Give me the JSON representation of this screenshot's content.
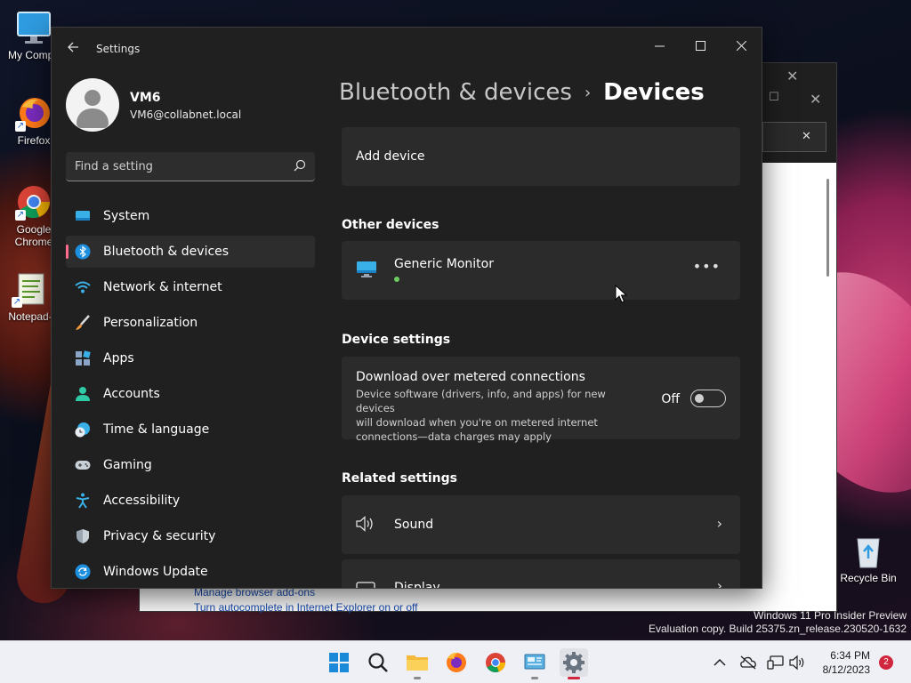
{
  "desktop": {
    "icons": [
      {
        "label": "My Compu",
        "icon": "computer-icon"
      },
      {
        "label": "Firefox",
        "icon": "firefox-icon"
      },
      {
        "label": "Google Chrome",
        "label_line1": "Google",
        "label_line2": "Chrome",
        "icon": "chrome-icon"
      },
      {
        "label": "Notepad-",
        "icon": "notepad-icon"
      },
      {
        "label": "Recycle Bin",
        "icon": "recycle-bin-icon"
      }
    ],
    "background_window": {
      "links": [
        "Manage browser add-ons",
        "Turn autocomplete in Internet Explorer on or off"
      ]
    },
    "watermark": {
      "line1": "Windows 11 Pro Insider Preview",
      "line2": "Evaluation copy. Build 25375.zn_release.230520-1632"
    }
  },
  "settings": {
    "window_title": "Settings",
    "profile": {
      "name": "VM6",
      "email": "VM6@collabnet.local"
    },
    "search": {
      "placeholder": "Find a setting"
    },
    "nav": [
      {
        "label": "System",
        "icon": "system-icon",
        "active": false
      },
      {
        "label": "Bluetooth & devices",
        "icon": "bluetooth-icon",
        "active": true
      },
      {
        "label": "Network & internet",
        "icon": "wifi-icon",
        "active": false
      },
      {
        "label": "Personalization",
        "icon": "brush-icon",
        "active": false
      },
      {
        "label": "Apps",
        "icon": "apps-icon",
        "active": false
      },
      {
        "label": "Accounts",
        "icon": "accounts-icon",
        "active": false
      },
      {
        "label": "Time & language",
        "icon": "time-language-icon",
        "active": false
      },
      {
        "label": "Gaming",
        "icon": "gamepad-icon",
        "active": false
      },
      {
        "label": "Accessibility",
        "icon": "accessibility-icon",
        "active": false
      },
      {
        "label": "Privacy & security",
        "icon": "shield-icon",
        "active": false
      },
      {
        "label": "Windows Update",
        "icon": "update-icon",
        "active": false
      }
    ],
    "breadcrumb": {
      "parent": "Bluetooth & devices",
      "separator": "›",
      "current": "Devices"
    },
    "add_device": {
      "label": "Add device"
    },
    "other_devices": {
      "heading": "Other devices",
      "device_name": "Generic Monitor",
      "more_label": "•••"
    },
    "device_settings": {
      "heading": "Device settings",
      "metered": {
        "title": "Download over metered connections",
        "description": "Device software (drivers, info, and apps) for new devices will download when you're on metered internet connections—data charges may apply",
        "desc_line1": "Device software (drivers, info, and apps) for new devices",
        "desc_line2": "will download when you're on metered internet",
        "desc_line3": "connections—data charges may apply",
        "toggle_label": "Off",
        "toggle_on": false
      }
    },
    "related_settings": {
      "heading": "Related settings",
      "items": [
        {
          "label": "Sound",
          "icon": "speaker-icon"
        },
        {
          "label": "Display",
          "icon": "display-icon"
        }
      ]
    }
  },
  "taskbar": {
    "apps": [
      "start-icon",
      "search-icon",
      "file-explorer-icon",
      "firefox-icon",
      "chrome-icon",
      "control-panel-icon",
      "settings-icon"
    ],
    "clock": {
      "time": "6:34 PM",
      "date": "8/12/2023"
    },
    "notifications": "2"
  },
  "colors": {
    "accent": "#ff6b8b",
    "window_bg": "#202020",
    "card_bg": "#2b2b2b",
    "status_green": "#6ccb5f"
  }
}
